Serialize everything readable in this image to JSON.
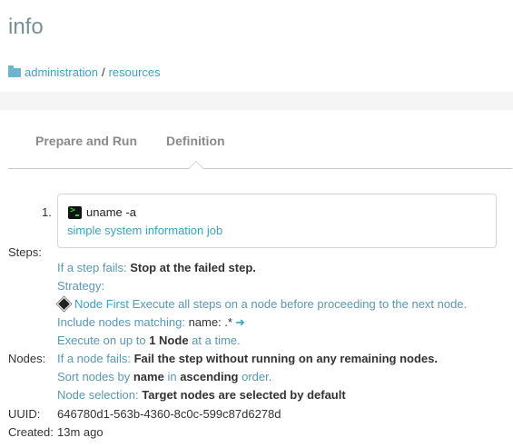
{
  "header": {
    "title": "info",
    "breadcrumb": {
      "parent": "administration",
      "separator": "/",
      "current": "resources"
    }
  },
  "tabs": [
    {
      "label": "Prepare and Run"
    },
    {
      "label": "Definition",
      "active": true
    }
  ],
  "labels": {
    "steps": "Steps:",
    "nodes": "Nodes:",
    "uuid": "UUID:",
    "created": "Created:"
  },
  "steps": {
    "items": [
      {
        "number": "1.",
        "command": "uname -a",
        "description": "simple system information job",
        "icon": "terminal-icon"
      }
    ],
    "on_fail_prefix": "If a step fails:",
    "on_fail_value": "Stop at the failed step.",
    "strategy_label": "Strategy:",
    "strategy_name": "Node First",
    "strategy_desc": "Execute all steps on a node before proceeding to the next node."
  },
  "nodes": {
    "include_label": "Include nodes matching:",
    "filter": "name: .*",
    "exec_prefix": "Execute on up to",
    "exec_count": "1 Node",
    "exec_suffix": "at a time.",
    "fail_prefix": "If a node fails:",
    "fail_value": "Fail the step without running on any remaining nodes.",
    "sort_prefix": "Sort nodes by",
    "sort_field": "name",
    "sort_in": "in",
    "sort_dir": "ascending",
    "sort_suffix": "order.",
    "selection_prefix": "Node selection:",
    "selection_value": "Target nodes are selected by default"
  },
  "meta": {
    "uuid": "646780d1-563b-4360-8c0c-599c87d6278d",
    "created": "13m ago"
  },
  "colors": {
    "link": "#3aa3c8",
    "muted": "#5a97b3",
    "title": "#7b8f97"
  }
}
